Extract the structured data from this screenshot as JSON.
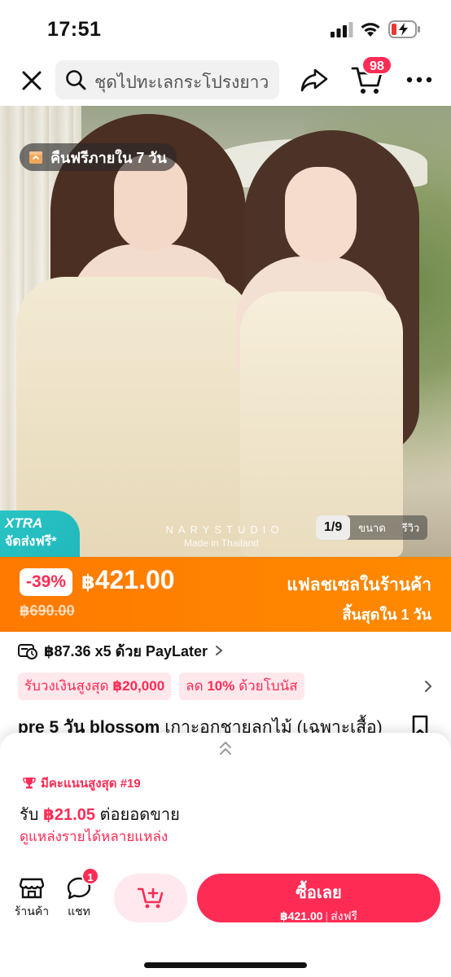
{
  "status_bar": {
    "time": "17:51"
  },
  "nav": {
    "search_text": "ชุดไปทะเลกระโปรงยาว",
    "cart_count": "98"
  },
  "hero": {
    "return_badge": "คืนฟรีภายใน 7 วัน",
    "watermark": "NARYSTUDIO",
    "watermark_sub": "Made in Thailand",
    "xtra_title": "XTRA",
    "xtra_sub": "จัดส่งฟรี*",
    "gallery_count": "1/9",
    "gallery_tab_size": "ขนาด",
    "gallery_tab_review": "รีวิว"
  },
  "price": {
    "discount": "-39%",
    "currency": "฿",
    "current": "421.00",
    "original": "฿690.00",
    "flash_label": "แฟลชเซลในร้านค้า",
    "flash_end": "สิ้นสุดใน 1 วัน",
    "banner_color": "#ff7a00"
  },
  "details": {
    "paylater": "฿87.36 x5 ด้วย PayLater",
    "promo_1_prefix": "รับวงเงินสูงสุด ",
    "promo_1_bold": "฿20,000",
    "promo_2_prefix": "ลด ",
    "promo_2_bold": "10%",
    "promo_2_suffix": " ด้วยโบนัส",
    "title_bold": "pre 5 วัน blossom",
    "title_rest": " เกาะอกชายลูกไม้ (เฉพาะเสื้อ)"
  },
  "sheet": {
    "rank": "มีคะแนนสูงสุด #19",
    "earn_prefix": "รับ ",
    "earn_amount": "฿21.05",
    "earn_suffix": " ต่อยอดขาย",
    "earn_link": "ดูแหล่งรายได้หลายแหล่ง"
  },
  "action_bar": {
    "shop_label": "ร้านค้า",
    "chat_label": "แชท",
    "chat_badge": "1",
    "buy_label": "ซื้อเลย",
    "buy_price": "฿421.00",
    "buy_shipping": "ส่งฟรี",
    "accent_color": "#fe2c55"
  }
}
